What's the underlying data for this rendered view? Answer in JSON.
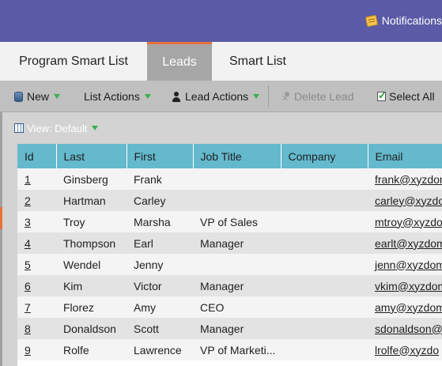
{
  "header": {
    "notifications_label": "Notifications",
    "notifications_icon": "notification-icon"
  },
  "tabs": [
    {
      "label": "Program Smart List",
      "active": false
    },
    {
      "label": "Leads",
      "active": true
    },
    {
      "label": "Smart List",
      "active": false
    }
  ],
  "toolbar": {
    "new_label": "New",
    "list_actions_label": "List Actions",
    "lead_actions_label": "Lead Actions",
    "delete_lead_label": "Delete Lead",
    "select_all_label": "Select All"
  },
  "view": {
    "label": "View: Default"
  },
  "grid": {
    "columns": [
      "Id",
      "Last",
      "First",
      "Job Title",
      "Company",
      "Email"
    ],
    "rows": [
      {
        "id": "1",
        "last": "Ginsberg",
        "first": "Frank",
        "job_title": "",
        "company": "",
        "email": "frank@xyzdom"
      },
      {
        "id": "2",
        "last": "Hartman",
        "first": "Carley",
        "job_title": "",
        "company": "",
        "email": "carley@xyzdon"
      },
      {
        "id": "3",
        "last": "Troy",
        "first": "Marsha",
        "job_title": "VP of Sales",
        "company": "",
        "email": "mtroy@xyzdom"
      },
      {
        "id": "4",
        "last": "Thompson",
        "first": "Earl",
        "job_title": "Manager",
        "company": "",
        "email": "earlt@xyzdom"
      },
      {
        "id": "5",
        "last": "Wendel",
        "first": "Jenny",
        "job_title": "",
        "company": "",
        "email": "jenn@xyzdom"
      },
      {
        "id": "6",
        "last": "Kim",
        "first": "Victor",
        "job_title": "Manager",
        "company": "",
        "email": "vkim@xyzdom"
      },
      {
        "id": "7",
        "last": "Florez",
        "first": "Amy",
        "job_title": "CEO",
        "company": "",
        "email": "amy@xyzdom"
      },
      {
        "id": "8",
        "last": "Donaldson",
        "first": "Scott",
        "job_title": "Manager",
        "company": "",
        "email": "sdonaldson@x"
      },
      {
        "id": "9",
        "last": "Rolfe",
        "first": "Lawrence",
        "job_title": "VP of Marketi...",
        "company": "",
        "email": "lrolfe@xyzdo"
      }
    ]
  },
  "colors": {
    "header_bg": "#5a5aa6",
    "active_tab_accent": "#e8713a",
    "grid_header_bg": "#64b9cd"
  }
}
